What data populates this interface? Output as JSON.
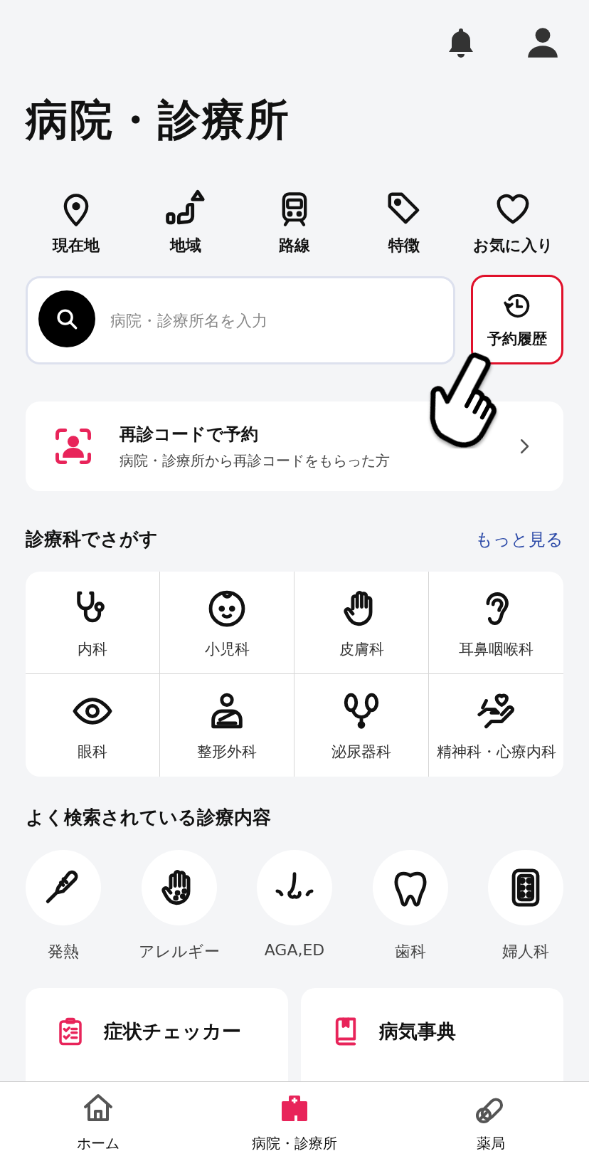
{
  "header": {
    "title": "病院・診療所"
  },
  "search_methods": [
    {
      "label": "現在地"
    },
    {
      "label": "地域"
    },
    {
      "label": "路線"
    },
    {
      "label": "特徴"
    },
    {
      "label": "お気に入り"
    }
  ],
  "search": {
    "placeholder": "病院・診療所名を入力"
  },
  "history_button": {
    "label": "予約履歴"
  },
  "revisit": {
    "title": "再診コードで予約",
    "subtitle": "病院・診療所から再診コードをもらった方"
  },
  "departments": {
    "title": "診療科でさがす",
    "more_link": "もっと見る",
    "items": [
      {
        "label": "内科"
      },
      {
        "label": "小児科"
      },
      {
        "label": "皮膚科"
      },
      {
        "label": "耳鼻咽喉科"
      },
      {
        "label": "眼科"
      },
      {
        "label": "整形外科"
      },
      {
        "label": "泌尿器科"
      },
      {
        "label": "精神科・心療内科"
      }
    ]
  },
  "popular": {
    "title": "よく検索されている診療内容",
    "items": [
      {
        "label": "発熱"
      },
      {
        "label": "アレルギー"
      },
      {
        "label": "AGA,ED"
      },
      {
        "label": "歯科"
      },
      {
        "label": "婦人科"
      }
    ]
  },
  "features": [
    {
      "title": "症状チェッカー"
    },
    {
      "title": "病気事典"
    }
  ],
  "tab_bar": [
    {
      "label": "ホーム",
      "selected": false
    },
    {
      "label": "病院・診療所",
      "selected": true
    },
    {
      "label": "薬局",
      "selected": false
    }
  ]
}
